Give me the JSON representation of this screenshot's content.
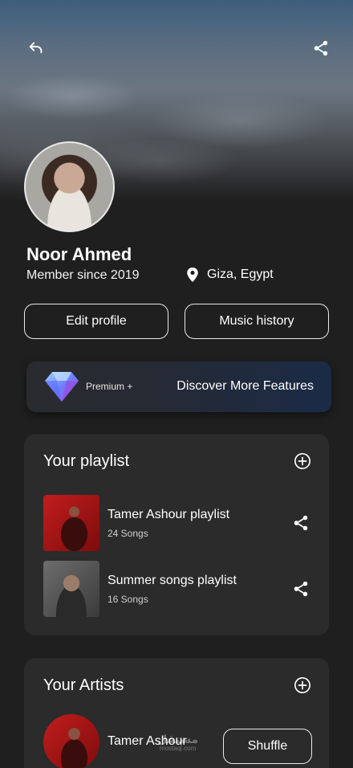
{
  "header": {
    "back_icon": "reply-arrow-icon",
    "share_icon": "share-icon"
  },
  "profile": {
    "name": "Noor Ahmed",
    "member_since": "Member since 2019",
    "location": "Giza, Egypt",
    "location_icon": "map-pin-icon"
  },
  "actions": {
    "edit_profile": "Edit profile",
    "music_history": "Music history"
  },
  "premium": {
    "label": "Premium +",
    "cta": "Discover More Features",
    "icon": "diamond-icon"
  },
  "playlist": {
    "title": "Your playlist",
    "items": [
      {
        "title": "Tamer Ashour playlist",
        "subtitle": "24 Songs"
      },
      {
        "title": "Summer songs playlist",
        "subtitle": "16 Songs"
      }
    ]
  },
  "artists": {
    "title": "Your Artists",
    "items": [
      {
        "name": "Tamer Ashour"
      }
    ],
    "shuffle": "Shuffle",
    "watermark": "مستقل",
    "watermark_sub": "mostaql.com"
  },
  "colors": {
    "background": "#1f1f1f",
    "card": "#2b2b2b",
    "premium_end": "#1a2b47",
    "accent_gem": "#6ea0ff"
  }
}
